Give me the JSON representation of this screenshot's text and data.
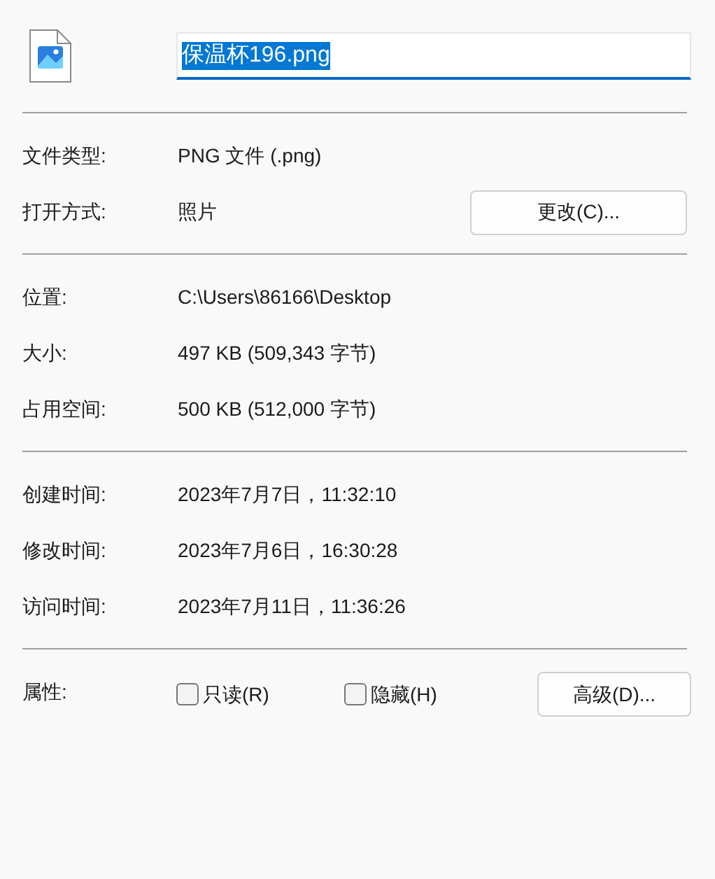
{
  "file_name": {
    "value": "保温杯196.png",
    "selected": true
  },
  "sections": [
    {
      "rows": [
        {
          "label": "文件类型:",
          "value": "PNG 文件 (.png)"
        },
        {
          "label": "打开方式:",
          "value": "照片",
          "button": "更改(C)..."
        }
      ]
    },
    {
      "rows": [
        {
          "label": "位置:",
          "value": "C:\\Users\\86166\\Desktop"
        },
        {
          "label": "大小:",
          "value": "497 KB (509,343 字节)"
        },
        {
          "label": "占用空间:",
          "value": "500 KB (512,000 字节)"
        }
      ]
    },
    {
      "rows": [
        {
          "label": "创建时间:",
          "value": "2023年7月7日，11:32:10"
        },
        {
          "label": "修改时间:",
          "value": "2023年7月6日，16:30:28"
        },
        {
          "label": "访问时间:",
          "value": "2023年7月11日，11:36:26"
        }
      ]
    }
  ],
  "attributes": {
    "label": "属性:",
    "checkboxes": [
      {
        "label": "只读(R)",
        "checked": false
      },
      {
        "label": "隐藏(H)",
        "checked": false
      }
    ],
    "button": "高级(D)..."
  }
}
